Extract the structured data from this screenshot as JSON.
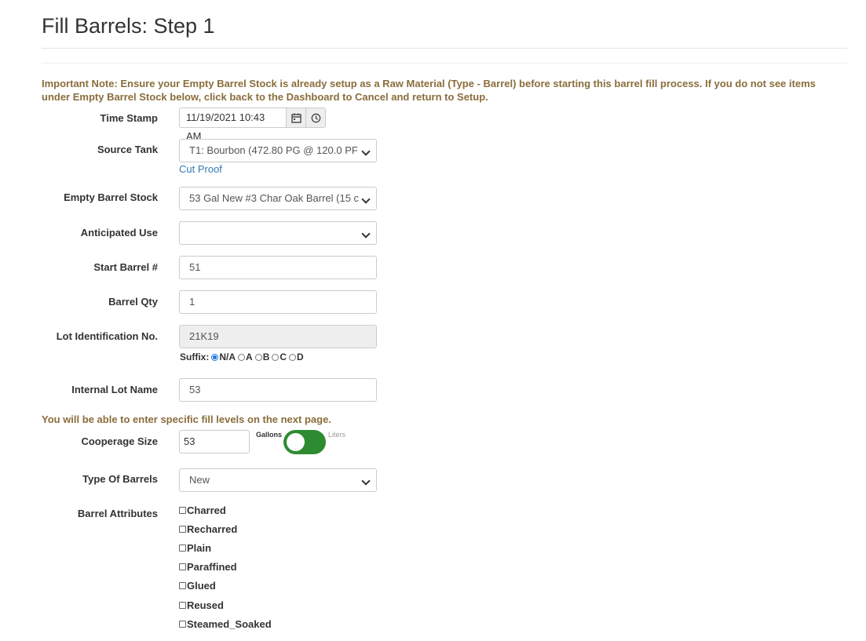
{
  "page": {
    "title": "Fill Barrels: Step 1",
    "note": "Important Note: Ensure your Empty Barrel Stock is already setup as a Raw Material (Type - Barrel) before starting this barrel fill process. If you do not see items under Empty Barrel Stock below, click back to the Dashboard to Cancel and return to Setup.",
    "fill_note": "You will be able to enter specific fill levels on the next page."
  },
  "form": {
    "time_stamp": {
      "label": "Time Stamp",
      "value": "11/19/2021 10:43 AM"
    },
    "source_tank": {
      "label": "Source Tank",
      "value": "T1: Bourbon (472.80 PG @ 120.0 PF",
      "link": "Cut Proof"
    },
    "empty_barrel_stock": {
      "label": "Empty Barrel Stock",
      "value": "53 Gal New #3 Char Oak Barrel (15 c"
    },
    "anticipated_use": {
      "label": "Anticipated Use",
      "value": ""
    },
    "start_barrel": {
      "label": "Start Barrel #",
      "value": "51"
    },
    "barrel_qty": {
      "label": "Barrel Qty",
      "value": "1"
    },
    "lot_id": {
      "label": "Lot Identification No.",
      "value": "21K19",
      "suffix_label": "Suffix:",
      "suffix_options": [
        "N/A",
        "A",
        "B",
        "C",
        "D"
      ],
      "suffix_selected": "N/A"
    },
    "internal_lot_name": {
      "label": "Internal Lot Name",
      "value": "53"
    },
    "cooperage_size": {
      "label": "Cooperage Size",
      "value": "53",
      "unit_left": "Gallons",
      "unit_right": "Liters",
      "selected_unit": "Gallons"
    },
    "type_of_barrels": {
      "label": "Type Of Barrels",
      "value": "New"
    },
    "barrel_attributes": {
      "label": "Barrel Attributes",
      "options": [
        "Charred",
        "Recharred",
        "Plain",
        "Paraffined",
        "Glued",
        "Reused",
        "Steamed_Soaked"
      ]
    }
  },
  "colors": {
    "note": "#8a6d3b",
    "link": "#337ab7",
    "toggle_on": "#2e8b32",
    "readonly_bg": "#eeeeee"
  }
}
